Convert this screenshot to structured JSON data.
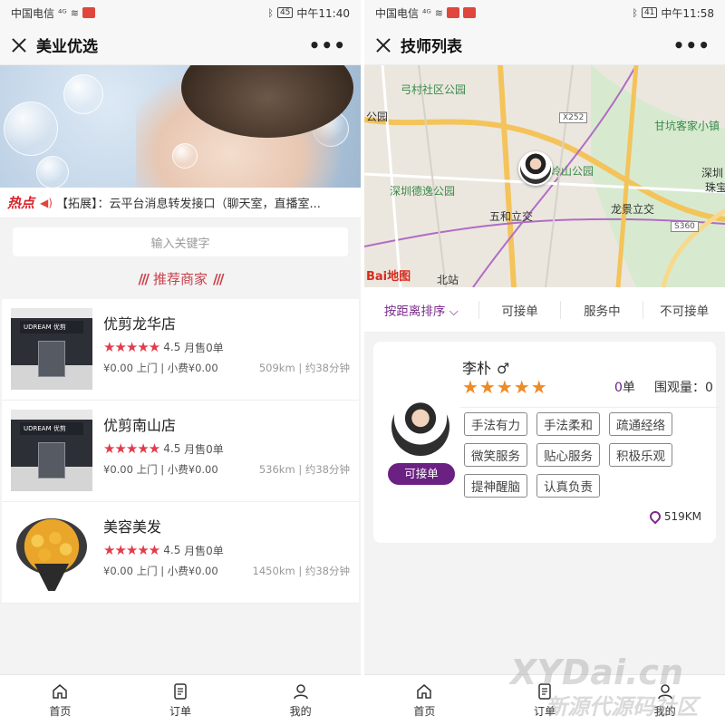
{
  "left": {
    "status": {
      "carrier": "中国电信",
      "net": "⁴ᴳ",
      "battery": "45",
      "time": "中午11:40"
    },
    "title": "美业优选",
    "more": "•••",
    "hot": {
      "tag": "热点",
      "text": "【拓展】：云平台消息转发接口（聊天室，直播室..."
    },
    "search_placeholder": "输入关键字",
    "section_title": "推荐商家",
    "stores": [
      {
        "name": "优剪龙华店",
        "rating": "4.5",
        "sales": "月售0单",
        "fee": "¥0.00 上门 | 小费¥0.00",
        "distance": "509km | 约38分钟",
        "image": "shopfront",
        "sign": "UDREAM 优剪"
      },
      {
        "name": "优剪南山店",
        "rating": "4.5",
        "sales": "月售0单",
        "fee": "¥0.00 上门 | 小费¥0.00",
        "distance": "536km | 约38分钟",
        "image": "shopfront",
        "sign": "UDREAM 优剪"
      },
      {
        "name": "美容美发",
        "rating": "4.5",
        "sales": "月售0单",
        "fee": "¥0.00 上门 | 小费¥0.00",
        "distance": "1450km | 约38分钟",
        "image": "flowers"
      }
    ],
    "nav": [
      {
        "label": "首页",
        "icon": "home-icon"
      },
      {
        "label": "订单",
        "icon": "order-icon"
      },
      {
        "label": "我的",
        "icon": "user-icon"
      }
    ]
  },
  "right": {
    "status": {
      "carrier": "中国电信",
      "net": "⁴ᴳ",
      "battery": "41",
      "time": "中午11:58"
    },
    "title": "技师列表",
    "more": "•••",
    "map": {
      "labels": [
        "弓村社区公园",
        "甘坑客家小镇",
        "深圳德逸公园",
        "五和立交",
        "龙景立交",
        "岭山公园",
        "公园",
        "北站",
        "深圳",
        "珠宝"
      ],
      "roads": [
        "X252",
        "S360"
      ],
      "brand": "Bai地图"
    },
    "tabs": [
      "按距离排序",
      "可接单",
      "服务中",
      "不可接单"
    ],
    "technician": {
      "name": "李朴",
      "gender": "♂",
      "stars": "★★★★★",
      "orders_num": "0",
      "orders_unit": "单",
      "views": "围观量：0",
      "status": "可接单",
      "skills": [
        "手法有力",
        "手法柔和",
        "疏通经络",
        "微笑服务",
        "贴心服务",
        "积极乐观",
        "提神醒脑",
        "认真负责"
      ],
      "distance": "519KM"
    },
    "nav": [
      {
        "label": "首页",
        "icon": "home-icon"
      },
      {
        "label": "订单",
        "icon": "order-icon"
      },
      {
        "label": "我的",
        "icon": "user-icon"
      }
    ]
  },
  "watermark": {
    "line1": "XYDai.cn",
    "line2": "新源代源码社区"
  },
  "colors": {
    "accent_red": "#e23c4b",
    "accent_purple": "#6a2182",
    "star_orange": "#f08a24"
  }
}
